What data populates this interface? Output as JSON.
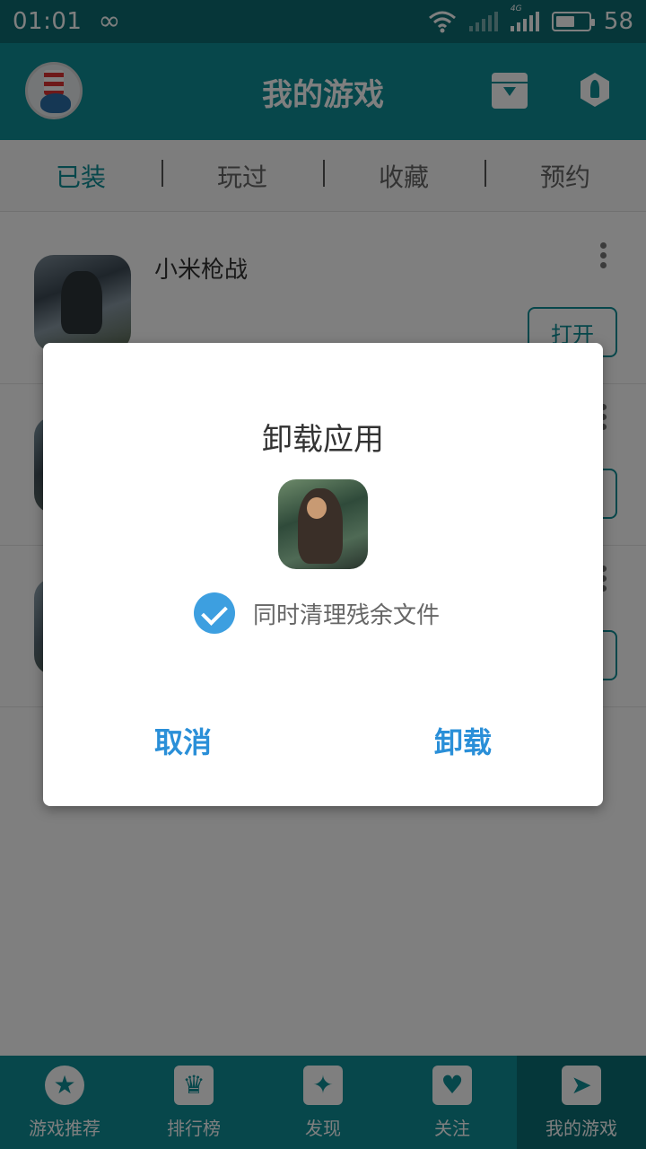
{
  "status_bar": {
    "time": "01:01",
    "infinity_symbol": "∞",
    "network_type": "4G",
    "battery": "58",
    "battery_level": 0.58
  },
  "app_bar": {
    "title": "我的游戏",
    "icons": [
      "avatar",
      "download-box-icon",
      "rocket-icon"
    ]
  },
  "tabs": [
    {
      "label": "已装",
      "active": true
    },
    {
      "label": "玩过",
      "active": false
    },
    {
      "label": "收藏",
      "active": false
    },
    {
      "label": "预约",
      "active": false
    }
  ],
  "games": [
    {
      "name": "小米枪战",
      "action_label": "打开"
    },
    {
      "name": "",
      "action_label": ""
    },
    {
      "name": "",
      "action_label": ""
    }
  ],
  "dialog": {
    "title": "卸载应用",
    "checkbox_label": "同时清理残余文件",
    "checkbox_checked": true,
    "cancel_label": "取消",
    "confirm_label": "卸载"
  },
  "bottom_nav": [
    {
      "label": "游戏推荐",
      "icon": "star-icon",
      "active": false
    },
    {
      "label": "排行榜",
      "icon": "trophy-icon",
      "active": false
    },
    {
      "label": "发现",
      "icon": "sparkle-icon",
      "active": false
    },
    {
      "label": "关注",
      "icon": "heart-icon",
      "active": false
    },
    {
      "label": "我的游戏",
      "icon": "paper-plane-icon",
      "active": true
    }
  ],
  "colors": {
    "header": "#0e8e96",
    "status_bar": "#0d6c72",
    "accent_blue": "#2a8fd8",
    "check_blue": "#3d9fe0"
  }
}
